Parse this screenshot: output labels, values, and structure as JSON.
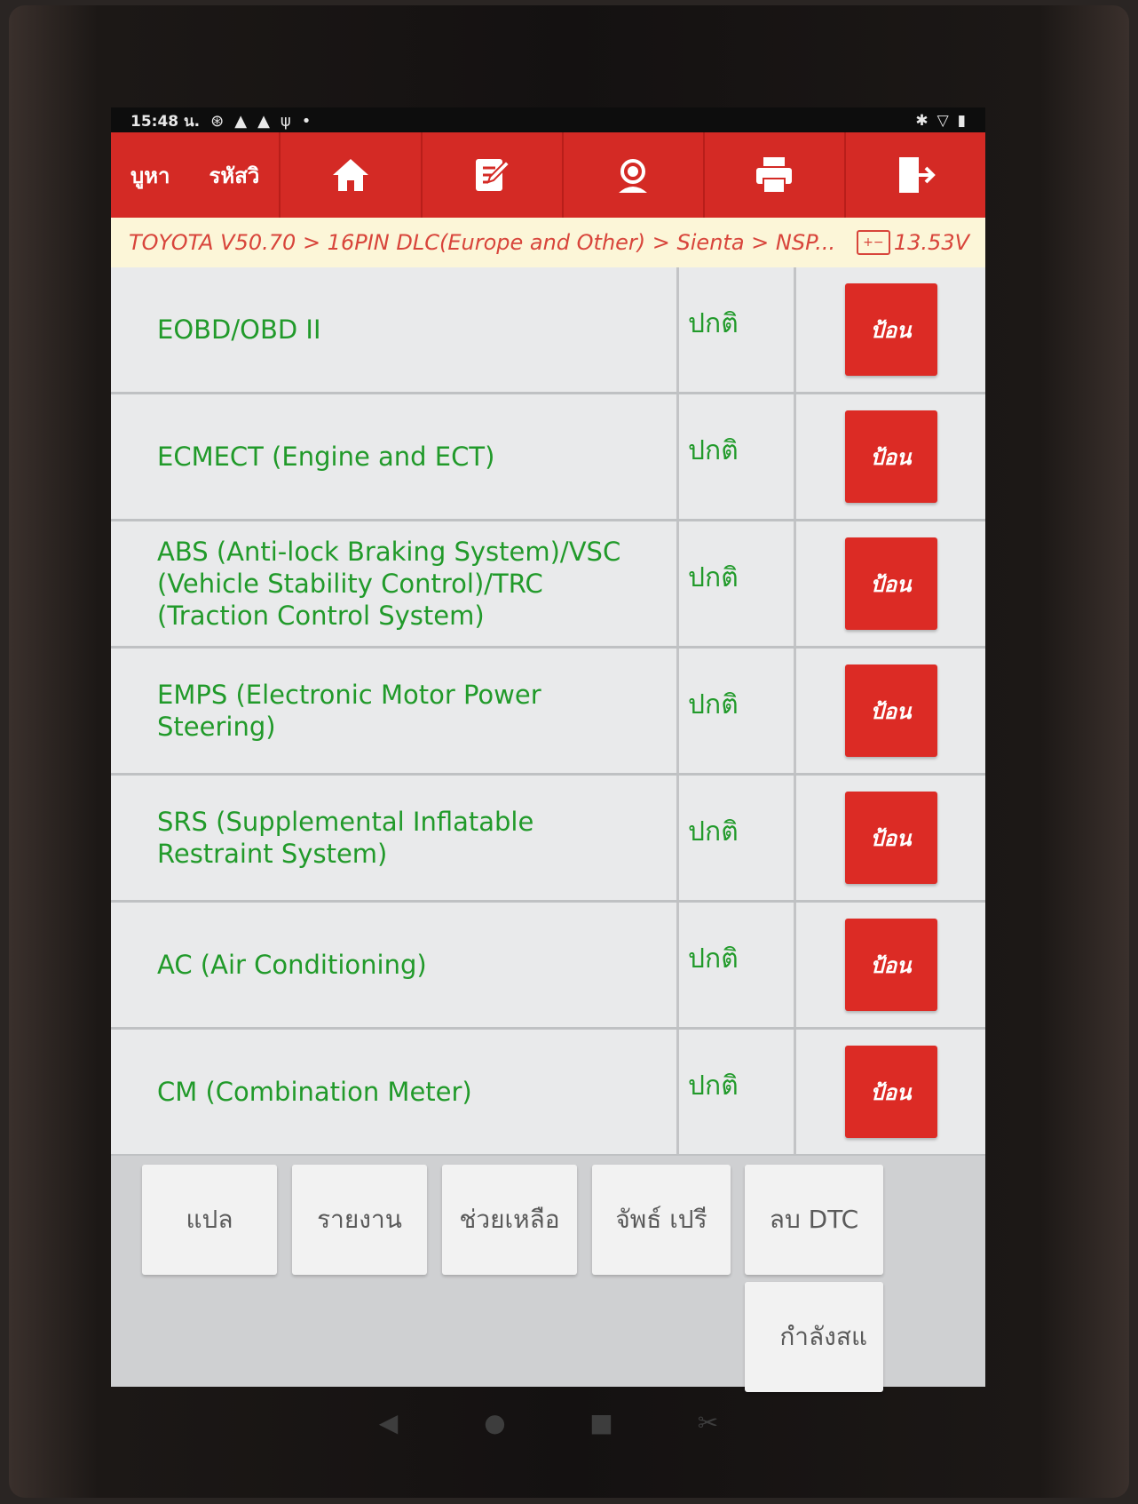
{
  "status_bar": {
    "time": "15:48 น.",
    "icons": [
      "settings-icon",
      "warning-icon",
      "warning-icon",
      "usb-icon",
      "dot-icon"
    ],
    "right_icons": [
      "bluetooth-icon",
      "wifi-icon",
      "battery-icon"
    ]
  },
  "toolbar": {
    "search_label": "บูหา",
    "code_label": "รหัสวิ",
    "buttons": [
      "home-icon",
      "edit-icon",
      "support-icon",
      "print-icon",
      "exit-icon"
    ]
  },
  "breadcrumb": {
    "path": "TOYOTA V50.70 > 16PIN DLC(Europe and Other) > Sienta > NSP...",
    "voltage": "13.53V",
    "battery_glyph": "+−"
  },
  "systems": [
    {
      "name": "EOBD/OBD II",
      "status": "ปกติ",
      "button": "ป้อน"
    },
    {
      "name": "ECMECT (Engine and ECT)",
      "status": "ปกติ",
      "button": "ป้อน"
    },
    {
      "name": "ABS (Anti-lock Braking System)/VSC (Vehicle Stability Control)/TRC (Traction Control System)",
      "status": "ปกติ",
      "button": "ป้อน"
    },
    {
      "name": "EMPS (Electronic Motor Power Steering)",
      "status": "ปกติ",
      "button": "ป้อน"
    },
    {
      "name": "SRS (Supplemental Inflatable Restraint System)",
      "status": "ปกติ",
      "button": "ป้อน"
    },
    {
      "name": "AC (Air Conditioning)",
      "status": "ปกติ",
      "button": "ป้อน"
    },
    {
      "name": "CM (Combination Meter)",
      "status": "ปกติ",
      "button": "ป้อน"
    }
  ],
  "bottom_buttons": {
    "translate": "แปล",
    "report": "รายงาน",
    "help": "ช่วยเหลือ",
    "print": "จัพธ์     เปรี",
    "clear_dtc": "ลบ DTC",
    "in_progress": "กำลังสแ"
  },
  "colors": {
    "accent_red": "#d42a25",
    "ok_green": "#219a2a",
    "breadcrumb_bg": "#fcf6d8"
  }
}
